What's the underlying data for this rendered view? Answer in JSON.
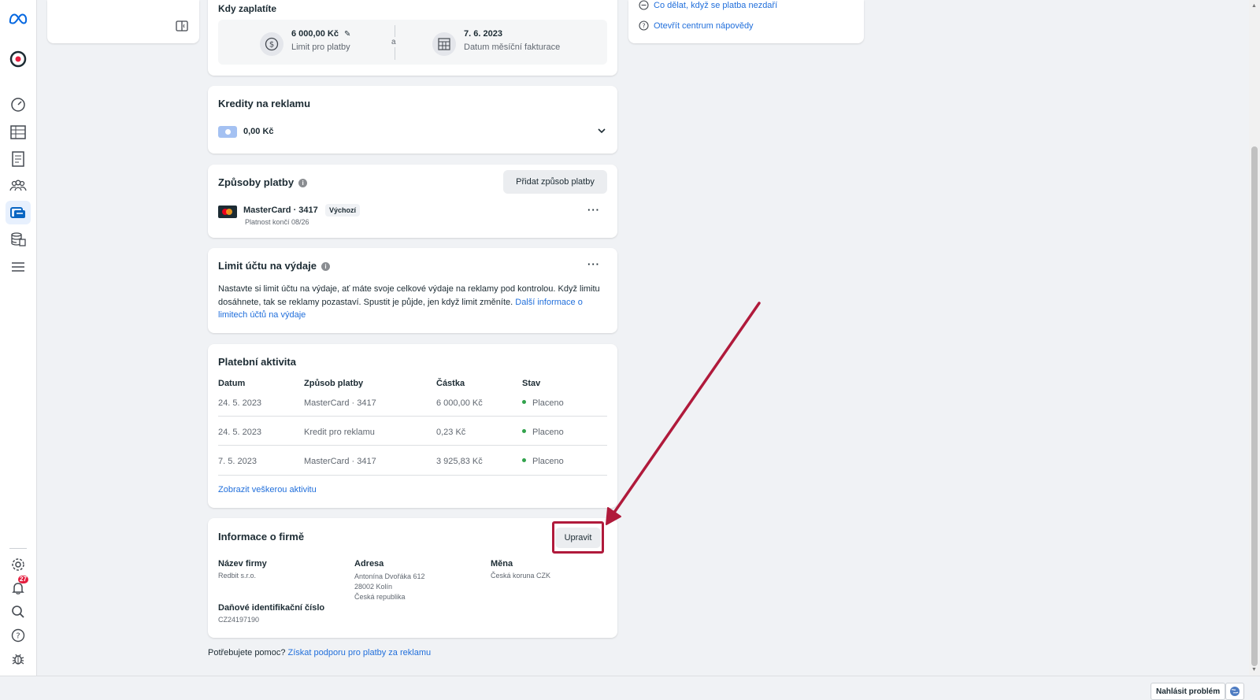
{
  "payment_schedule": {
    "title": "Kdy zaplatíte",
    "limit_value": "6 000,00 Kč",
    "limit_label": "Limit pro platby",
    "separator": "a",
    "billing_date_value": "7. 6. 2023",
    "billing_date_label": "Datum měsíční fakturace"
  },
  "help_links": {
    "payment_failed": "Co dělat, když se platba nezdaří",
    "help_center": "Otevřít centrum nápovědy"
  },
  "credits": {
    "title": "Kredity na reklamu",
    "amount": "0,00 Kč"
  },
  "payment_methods": {
    "title": "Způsoby platby",
    "add_button": "Přidat způsob platby",
    "card_name": "MasterCard · 3417",
    "default_badge": "Výchozí",
    "expiry": "Platnost končí 08/26"
  },
  "spending_limit": {
    "title": "Limit účtu na výdaje",
    "body": "Nastavte si limit účtu na výdaje, ať máte svoje celkové výdaje na reklamy pod kontrolou. Když limitu dosáhnete, tak se reklamy pozastaví. Spustit je půjde, jen když limit změníte.",
    "link": "Další informace o limitech účtů na výdaje"
  },
  "activity": {
    "title": "Platební aktivita",
    "headers": [
      "Datum",
      "Způsob platby",
      "Částka",
      "Stav"
    ],
    "rows": [
      [
        "24. 5. 2023",
        "MasterCard · 3417",
        "6 000,00 Kč",
        "Placeno"
      ],
      [
        "24. 5. 2023",
        "Kredit pro reklamu",
        "0,23 Kč",
        "Placeno"
      ],
      [
        "7. 5. 2023",
        "MasterCard · 3417",
        "3 925,83 Kč",
        "Placeno"
      ]
    ],
    "status_color": "#31a24c",
    "view_all": "Zobrazit veškerou aktivitu"
  },
  "business_info": {
    "title": "Informace o firmě",
    "edit_button": "Upravit",
    "name_label": "Název firmy",
    "name_value": "Redbit s.r.o.",
    "address_label": "Adresa",
    "address_line1": "Antonína Dvořáka 612",
    "address_line2": "28002 Kolín",
    "address_line3": "Česká republika",
    "currency_label": "Měna",
    "currency_value": "Česká koruna CZK",
    "tax_label": "Daňové identifikační číslo",
    "tax_value": "CZ24197190"
  },
  "footer": {
    "help_prompt": "Potřebujete pomoc?",
    "help_link": "Získat podporu pro platby za reklamu"
  },
  "bottom_bar": {
    "report_button": "Nahlásit problém"
  },
  "sidebar": {
    "notification_count": "27"
  },
  "annotation": {
    "color": "#b01a3b"
  }
}
